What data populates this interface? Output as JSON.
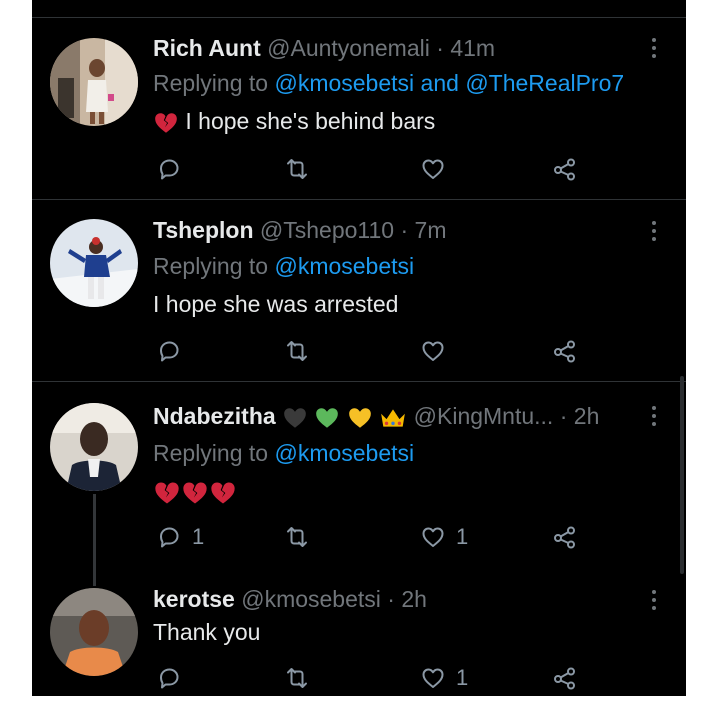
{
  "tweets": [
    {
      "name": "Rich Aunt",
      "handle": "@Auntyonemali",
      "sep": "·",
      "time": "41m",
      "replying_label": "Replying to",
      "mention1": "@kmosebetsi",
      "and_label": "and",
      "mention2": "@TheRealPro7",
      "text": "I hope she's behind bars",
      "emoji": "broken-heart"
    },
    {
      "name": "Tsheplon",
      "handle": "@Tshepo110",
      "sep": "·",
      "time": "7m",
      "replying_label": "Replying to",
      "mention1": "@kmosebetsi",
      "text": "I hope she was arrested"
    },
    {
      "name": "Ndabezitha",
      "name_emojis": [
        "black-heart",
        "green-heart",
        "yellow-heart",
        "crown"
      ],
      "handle": "@KingMntu...",
      "sep": "·",
      "time": "2h",
      "replying_label": "Replying to",
      "mention1": "@kmosebetsi",
      "text_emojis": [
        "broken-heart",
        "broken-heart",
        "broken-heart"
      ],
      "reply_count": "1",
      "like_count": "1"
    },
    {
      "name": "kerotse",
      "handle": "@kmosebetsi",
      "sep": "·",
      "time": "2h",
      "text": "Thank you",
      "like_count": "1"
    }
  ],
  "colors": {
    "background": "#000000",
    "text": "#e7e9ea",
    "muted": "#71767b",
    "mention": "#1d9bf0",
    "divider": "#2f3336"
  },
  "icons": [
    "reply-icon",
    "retweet-icon",
    "like-icon",
    "share-icon",
    "more-icon"
  ]
}
